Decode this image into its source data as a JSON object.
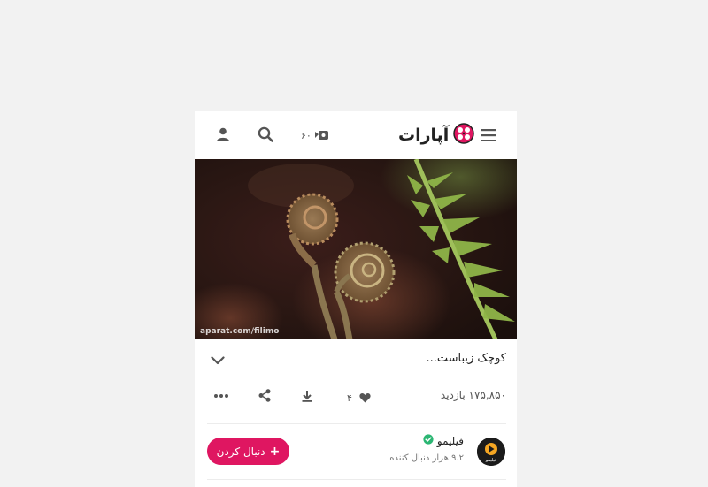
{
  "header": {
    "logo_text": "آپارات",
    "live_count": "۶۰",
    "icons": [
      "menu-icon",
      "aparat-logo-icon",
      "live-tv-icon",
      "search-icon",
      "user-icon"
    ]
  },
  "video": {
    "watermark": "aparat.com/filimo"
  },
  "info": {
    "title": "کوچک زیباست...",
    "views": "۱۷۵,۸۵۰ بازدید",
    "likes": "۴"
  },
  "channel": {
    "name": "فیلیمو",
    "followers": "۹.۲ هزار دنبال کننده",
    "avatar_label": "فیلیمو",
    "follow_label": "دنبال کردن"
  },
  "colors": {
    "accent": "#df1661",
    "verified": "#2bb673",
    "background": "#f2f2f2",
    "panel": "#ffffff"
  }
}
